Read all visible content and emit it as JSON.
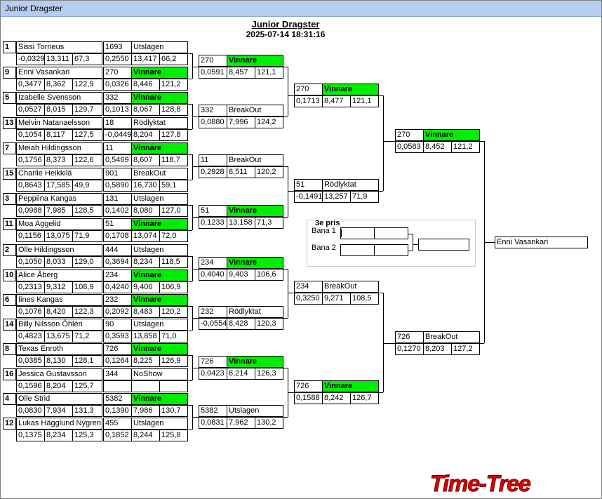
{
  "window": {
    "title": "Junior Dragster"
  },
  "header": {
    "title": "Junior Dragster",
    "datetime": "2025-07-14 18:31:16"
  },
  "round1": [
    {
      "seed": "1",
      "name": "Sissi Torneus",
      "rt": "-0,0329",
      "et": "13,311",
      "spd": "67,3"
    },
    {
      "seed": "9",
      "name": "Enni Vasankari",
      "rt": "0,3477",
      "et": "8,362",
      "spd": "122,9"
    },
    {
      "seed": "5",
      "name": "Izabelle Svensson",
      "rt": "0,0527",
      "et": "8,015",
      "spd": "129,7"
    },
    {
      "seed": "13",
      "name": "Melvin Natanaelsson",
      "rt": "0,1054",
      "et": "8,117",
      "spd": "127,5"
    },
    {
      "seed": "7",
      "name": "Meiah Hildingsson",
      "rt": "0,1756",
      "et": "8,373",
      "spd": "122,6"
    },
    {
      "seed": "15",
      "name": "Charlie Heikkilä",
      "rt": "0,8643",
      "et": "17,585",
      "spd": "49,9"
    },
    {
      "seed": "3",
      "name": "Peppiina Kangas",
      "rt": "0,0988",
      "et": "7,985",
      "spd": "128,5"
    },
    {
      "seed": "11",
      "name": "Moa Aggelid",
      "rt": "0,1156",
      "et": "13,075",
      "spd": "71,9"
    },
    {
      "seed": "2",
      "name": "Olle Hildingsson",
      "rt": "0,1050",
      "et": "8,033",
      "spd": "129,0"
    },
    {
      "seed": "10",
      "name": "Alice Åberg",
      "rt": "0,2313",
      "et": "9,312",
      "spd": "108,9"
    },
    {
      "seed": "6",
      "name": "Iines Kangas",
      "rt": "0,1076",
      "et": "8,420",
      "spd": "122,3"
    },
    {
      "seed": "14",
      "name": "Billy Nilsson Öhlén",
      "rt": "0,4823",
      "et": "13,675",
      "spd": "71,2"
    },
    {
      "seed": "8",
      "name": "Texas Enroth",
      "rt": "0,0385",
      "et": "8,130",
      "spd": "128,1"
    },
    {
      "seed": "16",
      "name": "Jessica Gustavsson",
      "rt": "0,1596",
      "et": "8,204",
      "spd": "125,7"
    },
    {
      "seed": "4",
      "name": "Olle Strid",
      "rt": "0,0830",
      "et": "7,934",
      "spd": "131,3"
    },
    {
      "seed": "12",
      "name": "Lukas Hägglund Nygren",
      "rt": "0,1375",
      "et": "8,234",
      "spd": "125,3"
    }
  ],
  "round2": [
    {
      "num": "1693",
      "status": "Utslagen",
      "win": false,
      "rt": "0,2550",
      "et": "13,417",
      "spd": "66,2"
    },
    {
      "num": "270",
      "status": "Vinnare",
      "win": true,
      "rt": "0,0326",
      "et": "8,446",
      "spd": "121,2"
    },
    {
      "num": "332",
      "status": "Vinnare",
      "win": true,
      "rt": "0,1013",
      "et": "8,067",
      "spd": "128,8"
    },
    {
      "num": "18",
      "status": "Rödlyktat",
      "win": false,
      "rt": "-0,0449",
      "et": "8,204",
      "spd": "127,8"
    },
    {
      "num": "11",
      "status": "Vinnare",
      "win": true,
      "rt": "0,5469",
      "et": "8,607",
      "spd": "118,7"
    },
    {
      "num": "901",
      "status": "BreakOut",
      "win": false,
      "rt": "0,5890",
      "et": "16,730",
      "spd": "59,1"
    },
    {
      "num": "131",
      "status": "Utslagen",
      "win": false,
      "rt": "0,1402",
      "et": "8,080",
      "spd": "127,0"
    },
    {
      "num": "51",
      "status": "Vinnare",
      "win": true,
      "rt": "0,1708",
      "et": "13,074",
      "spd": "72,0"
    },
    {
      "num": "444",
      "status": "Utslagen",
      "win": false,
      "rt": "0,3694",
      "et": "8,234",
      "spd": "118,5"
    },
    {
      "num": "234",
      "status": "Vinnare",
      "win": true,
      "rt": "0,4240",
      "et": "9,406",
      "spd": "106,9"
    },
    {
      "num": "232",
      "status": "Vinnare",
      "win": true,
      "rt": "0,2092",
      "et": "8,483",
      "spd": "120,2"
    },
    {
      "num": "90",
      "status": "Utslagen",
      "win": false,
      "rt": "0,3593",
      "et": "13,858",
      "spd": "71,0"
    },
    {
      "num": "726",
      "status": "Vinnare",
      "win": true,
      "rt": "0,1264",
      "et": "8,225",
      "spd": "126,9"
    },
    {
      "num": "344",
      "status": "NoShow",
      "win": false,
      "rt": "",
      "et": "",
      "spd": ""
    },
    {
      "num": "5382",
      "status": "Vinnare",
      "win": true,
      "rt": "0,1390",
      "et": "7,986",
      "spd": "130,7"
    },
    {
      "num": "455",
      "status": "Utslagen",
      "win": false,
      "rt": "0,1852",
      "et": "8,244",
      "spd": "125,8"
    }
  ],
  "round3": [
    {
      "num": "270",
      "status": "Vinnare",
      "win": true,
      "rt": "0,0591",
      "et": "8,457",
      "spd": "121,1"
    },
    {
      "num": "332",
      "status": "BreakOut",
      "win": false,
      "rt": "0,0880",
      "et": "7,996",
      "spd": "124,2"
    },
    {
      "num": "11",
      "status": "BreakOut",
      "win": false,
      "rt": "0,2928",
      "et": "8,511",
      "spd": "120,2"
    },
    {
      "num": "51",
      "status": "Vinnare",
      "win": true,
      "rt": "0,1233",
      "et": "13,158",
      "spd": "71,3"
    },
    {
      "num": "234",
      "status": "Vinnare",
      "win": true,
      "rt": "0,4040",
      "et": "9,403",
      "spd": "106,6"
    },
    {
      "num": "232",
      "status": "Rödlyktat",
      "win": false,
      "rt": "-0,0554",
      "et": "8,428",
      "spd": "120,3"
    },
    {
      "num": "726",
      "status": "Vinnare",
      "win": true,
      "rt": "0,0423",
      "et": "8,214",
      "spd": "126,3"
    },
    {
      "num": "5382",
      "status": "Utslagen",
      "win": false,
      "rt": "0,0831",
      "et": "7,962",
      "spd": "130,2"
    }
  ],
  "round4": [
    {
      "num": "270",
      "status": "Vinnare",
      "win": true,
      "rt": "0,1713",
      "et": "8,477",
      "spd": "121,1"
    },
    {
      "num": "51",
      "status": "Rödlyktat",
      "win": false,
      "rt": "-0,1491",
      "et": "13,257",
      "spd": "71,9"
    },
    {
      "num": "234",
      "status": "BreakOut",
      "win": false,
      "rt": "0,3250",
      "et": "9,271",
      "spd": "108,5"
    },
    {
      "num": "726",
      "status": "Vinnare",
      "win": true,
      "rt": "0,1588",
      "et": "8,242",
      "spd": "126,7"
    }
  ],
  "round5": [
    {
      "num": "270",
      "status": "Vinnare",
      "win": true,
      "rt": "0,0583",
      "et": "8,452",
      "spd": "121,2"
    },
    {
      "num": "726",
      "status": "BreakOut",
      "win": false,
      "rt": "0,1270",
      "et": "8,203",
      "spd": "127,2"
    }
  ],
  "final": {
    "winner": "Enni Vasankari"
  },
  "third_place": {
    "title": "3e pris",
    "lane1": "Bana 1",
    "lane2": "Bana 2"
  },
  "logo": {
    "text": "Time-Tree",
    "color": "#e00000"
  },
  "colors": {
    "winner": "#00ee00",
    "titlebar": "#b7cdf0"
  }
}
